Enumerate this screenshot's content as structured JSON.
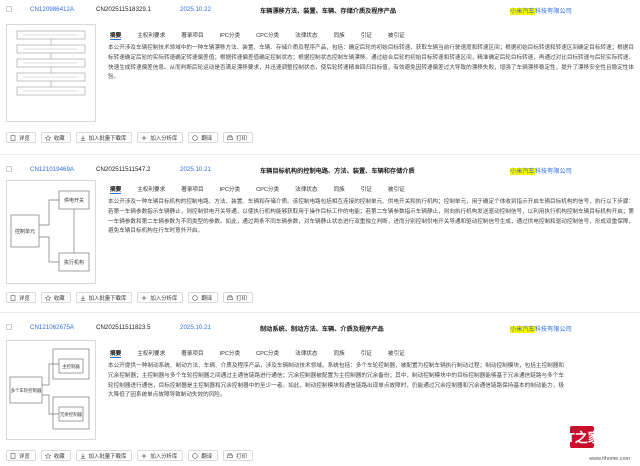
{
  "tabs": [
    "摘要",
    "主权利要求",
    "著录项目",
    "IPC分类",
    "CPC分类",
    "法律状态",
    "同族",
    "引证",
    "被引证"
  ],
  "actions": [
    "详览",
    "收藏",
    "加入批量下载库",
    "加入分析库",
    "翻译",
    "打印"
  ],
  "records": [
    {
      "app_no": "CN120986412A",
      "pub_no": "CN202511518329.1",
      "date": "2025.10.22",
      "title": "车辆漂移方法、装置、车辆、存储介质及程序产品",
      "applicant_hl": "小米汽车",
      "applicant_rest": "科技有限公司",
      "abstract": "本公开涉及车辆控制技术领域中的一种车辆漂移方法、装置、车辆、存储介质及程序产品，包括：确定后轮的初始目标转速，获取车辆当前行驶速度和转速区间；根据初始目标转速和转速区间确定目标转速；根据目标转速确定后轮的实际转速确定转速偏差值；根据转速偏差值确定控制状态；根据控制状态控制车辆漂移。通过结合后轮的初始目标转速和转速区间，精准确定后轮目标转速，再通过对比目标转速与后轮实际转速，快速生成转速偏差信息。从而判断后轮运动是否满足漂移要求，并迅速调整控制状态，使后轮转速精准回归目标值，有效避免因转速偏差过大导致的漂移失败，增强了车辆漂移稳定性，提升了漂移安全性且稳定性体验。"
    },
    {
      "app_no": "CN121019469A",
      "pub_no": "CN202511511547.2",
      "date": "2025.10.21",
      "title": "车辆目标机构的控制电路、方法、装置、车辆和存储介质",
      "applicant_hl": "小米汽车",
      "applicant_rest": "科技有限公司",
      "abstract": "本公开涉及一种车辆目标机构的控制电路、方法、装置、车辆和存储介质。该控制电路包括相互连接的控制单元、供电开关和执行机构；控制单元，用于确定个体收到指示开启车辆目标机构的信号，执行以下步骤：若第一车辆参数指示车辆静止，则控制供电开关导通，以使执行机构能够获取用于操作目标工作的电能；若第二车辆参数指示车辆静止，则向执行机构发送驱动控制信号，以利用执行机构控制车辆目标机构开启；第一车辆参数和第二车辆参数为不同类型的参数。如此，通过两条不同车辆参数，对车辆静止状态进行双重独立判断，进而分别控制供电开关导通和驱动控制信号生成，通过供电控制和驱动控制信号，形成双重保障，避免车辆目标机构在行车时意外开启。"
    },
    {
      "app_no": "CN121062675A",
      "pub_no": "CN202511511823.5",
      "date": "2025.10.21",
      "title": "制动系统、制动方法、车辆、介质及程序产品",
      "applicant_hl": "小米汽车",
      "applicant_rest": "科技有限公司",
      "abstract": "本公开提供一种制动系统、制动方法、车辆、介质及程序产品，涉及车辆制动技术领域。系统包括：多个车轮控制器，被配置为控制车辆执行制动过程；制动控制模块，包括主控制器和冗余控制器；主控制器与多个车轮控制器之间通过主通信链路进行通信；冗余控制器被配置为主控制器的冗余备份；其中，制动控制模块中的目标控制器能够基于冗余通信链路与多个车轮控制器进行通信，目标控制器是主控制器和冗余控制器中的至少一者。如此，制动控制模块和通信链路出现单点故障时，仍能通过冗余控制器和冗余通信链路保持基本的制动能力，极大降低了因系统单点故障导致制动失效的风险。"
    }
  ],
  "thumb2": {
    "box_top": "供电开关",
    "box_left": "控制单元",
    "box_bottom": "执行机构"
  },
  "thumb3": {
    "box_left": "多个车轮控制器",
    "box_top": "主控制器",
    "box_bottom": "冗余控制器"
  },
  "watermark": {
    "logo_text": "IT之家",
    "url": "www.ithome.com"
  }
}
